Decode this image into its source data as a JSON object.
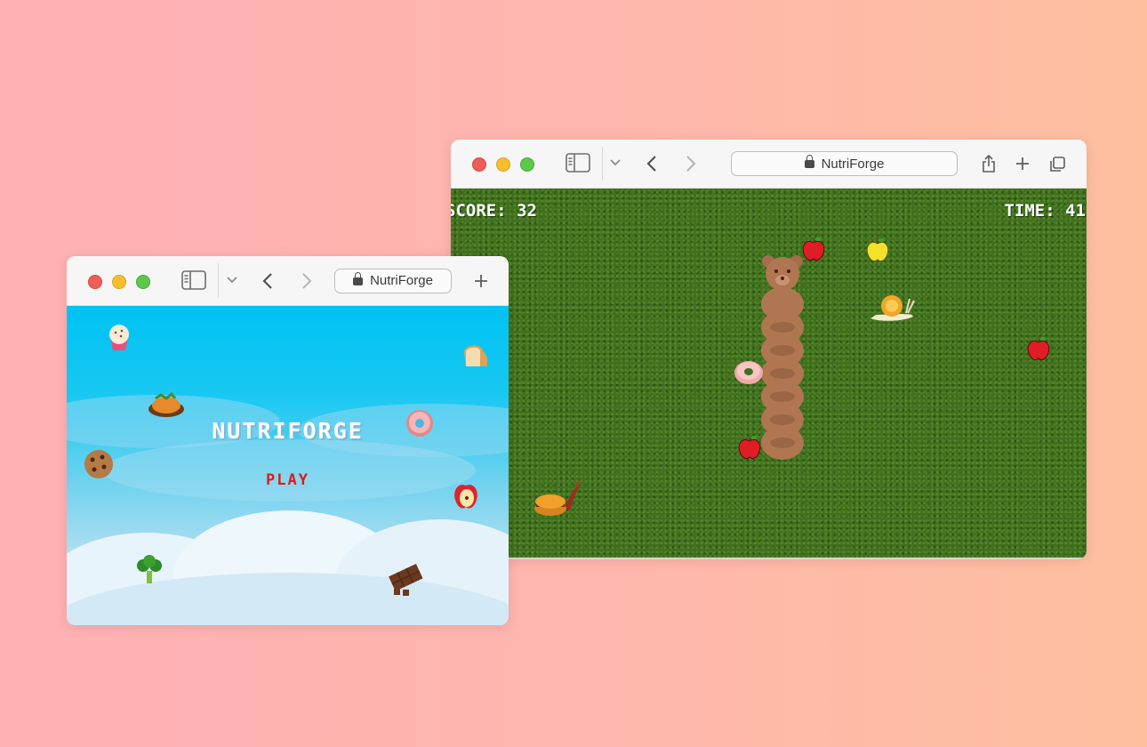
{
  "background": {
    "gradient_start": "#ffb1b4",
    "gradient_end": "#ffbf9f"
  },
  "menu_window": {
    "address": "NutriForge",
    "toolbar_icons": [
      "sidebar-icon",
      "chevron-down-icon",
      "back-icon",
      "forward-icon",
      "new-tab-icon"
    ],
    "game": {
      "title": "NUTRIFORGE",
      "play_label": "PLAY",
      "sky_color": "#00c2f3",
      "play_color": "#e01a1a",
      "foods": [
        "muffin",
        "bread",
        "roast-chicken",
        "donut",
        "cookie",
        "apple-slice",
        "broccoli",
        "chocolate-bar"
      ]
    }
  },
  "play_window": {
    "address": "NutriForge",
    "toolbar_icons": [
      "sidebar-icon",
      "chevron-down-icon",
      "back-icon",
      "forward-icon",
      "share-icon",
      "new-tab-icon",
      "tabs-overview-icon"
    ],
    "game": {
      "score_text": "SCORE: 32",
      "time_text": "TIME: 41",
      "score": 32,
      "time": 41,
      "grass_color": "#3f6f1f",
      "player": "bear",
      "items": [
        "red-apple",
        "yellow-apple",
        "snail",
        "red-apple",
        "donut",
        "red-apple",
        "burger-snail"
      ]
    }
  }
}
